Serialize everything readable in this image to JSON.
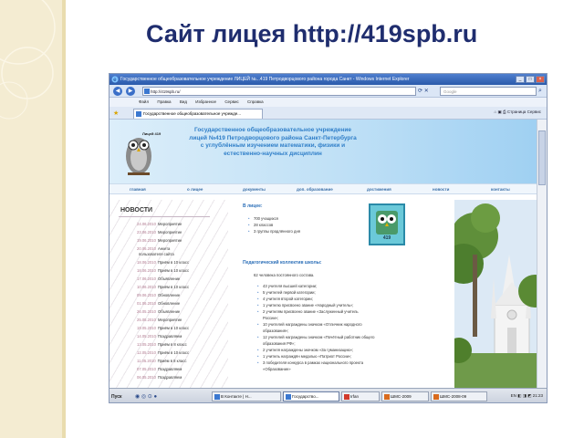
{
  "slide": {
    "title": "Сайт лицея http://419spb.ru"
  },
  "browser": {
    "window_title": "Государственное общеобразовательное учреждение ЛИЦЕЙ №...419 Петродворцового района города Санкт - Windows Internet Explorer",
    "address": "http://419spb.ru/",
    "search_placeholder": "Google",
    "menu": [
      "Файл",
      "Правка",
      "Вид",
      "Избранное",
      "Сервис",
      "Справка"
    ],
    "tab_label": "Государственное общеобразовательное учрежде...",
    "command_bar": {
      "page": "Страница",
      "tools": "Сервис"
    }
  },
  "site": {
    "logo_text": "Лицей 419",
    "banner": [
      "Государственное общеобразовательное учреждение",
      "лицей №419 Петродворцового района Санкт-Петербурга",
      "с углублённым изучением математики, физики и",
      "естественно-научных дисциплин"
    ],
    "nav": [
      "главная",
      "о лицее",
      "документы",
      "доп. образование",
      "достижения",
      "новости",
      "контакты"
    ],
    "news_title": "НОВОСТИ",
    "news": [
      {
        "date": "24.06.2010",
        "text": "Мероприятие"
      },
      {
        "date": "23.06.2010",
        "text": "Мероприятие"
      },
      {
        "date": "19.06.2010",
        "text": "Мероприятие"
      },
      {
        "date": "20.06.2010",
        "text": "Анкета"
      },
      {
        "date": "",
        "text": "пользователя сайта"
      },
      {
        "date": "18.06.2010",
        "text": "Приём в 10 класс"
      },
      {
        "date": "18.06.2010",
        "text": "Приём в 10 класс"
      },
      {
        "date": "17.06.2010",
        "text": "Объявление"
      },
      {
        "date": "10.06.2010",
        "text": "Приём в 10 класс"
      },
      {
        "date": "09.06.2010",
        "text": "Обновление"
      },
      {
        "date": "01.06.2010",
        "text": "Обновление"
      },
      {
        "date": "26.05.2010",
        "text": "Объявление"
      },
      {
        "date": "25.05.2010",
        "text": "Мероприятие"
      },
      {
        "date": "19.05.2010",
        "text": "Приём в 10 класс"
      },
      {
        "date": "14.05.2010",
        "text": "Поздравляем"
      },
      {
        "date": "13.05.2010",
        "text": "Приём в 8 класс"
      },
      {
        "date": "12.05.2010",
        "text": "Приём в 10 класс"
      },
      {
        "date": "11.05.2010",
        "text": "Приём в 8 класс"
      },
      {
        "date": "07.05.2010",
        "text": "Поздравляем"
      },
      {
        "date": "06.05.2010",
        "text": "Поздравляем"
      }
    ],
    "in_lyceum_title": "В лицее:",
    "in_lyceum": [
      "700 учащихся",
      "28 классов",
      "3 группы продлённого дня"
    ],
    "badge_number": "419",
    "staff_title": "Педагогический коллектив школы:",
    "staff_intro": "62 человека постоянного состава.",
    "staff_items": [
      "43 учителя высшей категории;",
      "5 учителей первой категории;",
      "4 учителя второй категории;",
      "1 учителю присвоено звание «Народный учитель»;",
      "2 учителям присвоено звание «Заслуженный учитель",
      "России»;",
      "10 учителей награждены значком «Отличник народного",
      "образования»;",
      "12 учителей награждены значком «Почётный работник общего",
      "образования РФ»;",
      "2 учителя награждены значком «За гуманизацию»;",
      "1 учитель награждён медалью «Патриот России»;",
      "3 победителя конкурса в рамках национального проекта",
      "«Образование»"
    ]
  },
  "taskbar": {
    "start": "Пуск",
    "buttons": [
      "В Контакте | Н...",
      "Государство...",
      "Irfan",
      "ШМС-2009",
      "ШМС-2008-09"
    ],
    "lang": "EN",
    "time": "21:23"
  }
}
